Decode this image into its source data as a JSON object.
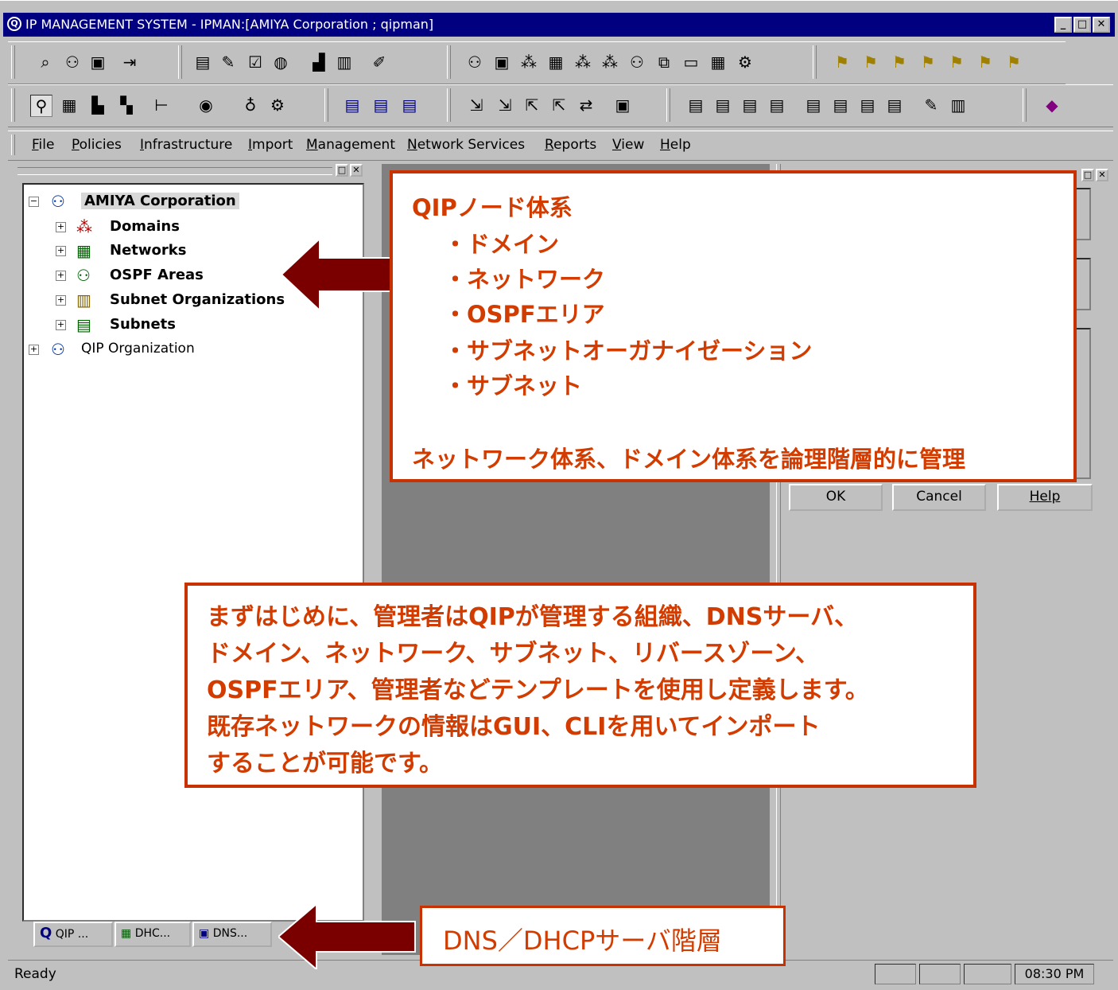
{
  "window": {
    "title": "IP MANAGEMENT SYSTEM - IPMAN:[AMIYA Corporation ; qipman]",
    "buttons": {
      "minimize": "_",
      "maximize": "□",
      "close": "✕"
    }
  },
  "menu": [
    "File",
    "Policies",
    "Infrastructure",
    "Import",
    "Management",
    "Network Services",
    "Reports",
    "View",
    "Help"
  ],
  "tree": {
    "root": "AMIYA Corporation",
    "children": [
      "Domains",
      "Networks",
      "OSPF Areas",
      "Subnet Organizations",
      "Subnets"
    ],
    "other_root": "QIP Organization"
  },
  "bottom_tabs": [
    "QIP ...",
    "DHC...",
    "DNS..."
  ],
  "dialog_buttons": {
    "ok": "OK",
    "cancel": "Cancel",
    "help": "Help"
  },
  "status": {
    "text": "Ready",
    "time": "08:30 PM"
  },
  "callout_node": {
    "title": "QIPノード体系",
    "items": [
      "・ドメイン",
      "・ネットワーク",
      "・OSPFエリア",
      "・サブネットオーガナイゼーション",
      "・サブネット"
    ],
    "footer": "ネットワーク体系、ドメイン体系を論理階層的に管理"
  },
  "callout_intro": {
    "lines": [
      "まずはじめに、管理者はQIPが管理する組織、DNSサーバ、",
      "ドメイン、ネットワーク、サブネット、リバースゾーン、",
      "OSPFエリア、管理者などテンプレートを使用し定義します。",
      "既存ネットワークの情報はGUI、CLIを用いてインポート",
      "することが可能です。"
    ]
  },
  "callout_server": {
    "text": "DNS／DHCPサーバ階層"
  },
  "colors": {
    "accent": "#c83200",
    "text_accent": "#d23c00",
    "arrow": "#7a0000",
    "titlebar": "#000080"
  }
}
